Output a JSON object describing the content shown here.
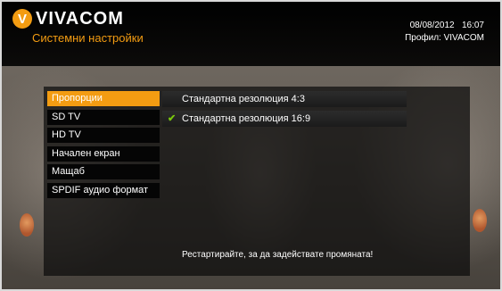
{
  "header": {
    "logo_letter": "V",
    "logo_text": "VIVACOM",
    "subtitle": "Системни настройки",
    "date": "08/08/2012",
    "time": "16:07",
    "profile": "Профил: VIVACOM"
  },
  "left_menu": {
    "items": [
      {
        "label": "Пропорции",
        "active": true
      },
      {
        "label": "SD TV",
        "active": false
      },
      {
        "label": "HD TV",
        "active": false
      },
      {
        "label": "Начален екран",
        "active": false
      },
      {
        "label": "Мащаб",
        "active": false
      },
      {
        "label": "SPDIF аудио формат",
        "active": false
      }
    ]
  },
  "options": {
    "items": [
      {
        "label": "Стандартна резолюция 4:3",
        "checked": false
      },
      {
        "label": "Стандартна резолюция 16:9",
        "checked": true
      }
    ],
    "check_icon": "checkmark-icon"
  },
  "message": "Рестартирайте, за да задействате промяната!",
  "colors": {
    "accent": "#f39c12",
    "check": "#7ac70c"
  }
}
